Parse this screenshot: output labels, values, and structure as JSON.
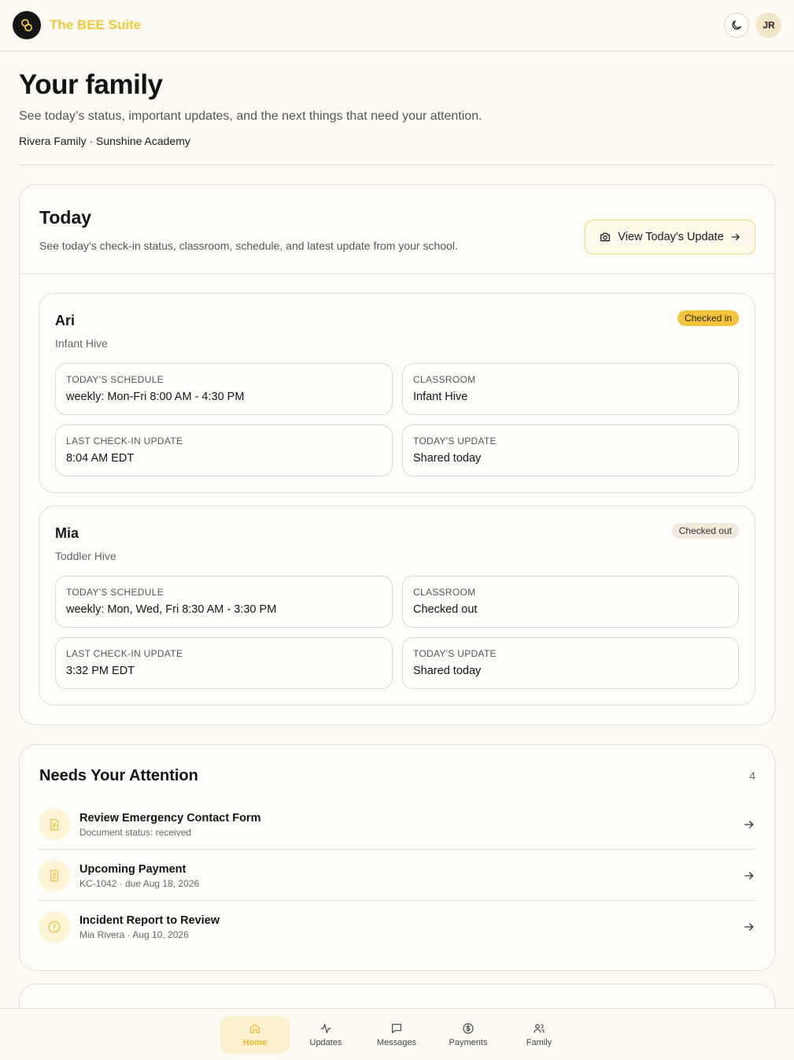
{
  "app": {
    "title": "The BEE Suite",
    "avatar_initials": "JR",
    "accent_color": "#f1c93a"
  },
  "header": {
    "title": "Your family",
    "subtitle": "See today’s status, important updates, and the next things that need your attention.",
    "meta": "Rivera Family · Sunshine Academy"
  },
  "today": {
    "title": "Today",
    "description": "See today's check-in status, classroom, schedule, and latest update from your school.",
    "view_button": "View Today's Update",
    "children": [
      {
        "name": "Ari",
        "classroom_name": "Infant Hive",
        "status": "Checked in",
        "fields": [
          {
            "label": "TODAY'S SCHEDULE",
            "value": "weekly: Mon-Fri 8:00 AM - 4:30 PM"
          },
          {
            "label": "CLASSROOM",
            "value": "Infant Hive"
          },
          {
            "label": "LAST CHECK-IN UPDATE",
            "value": "8:04 AM EDT"
          },
          {
            "label": "TODAY'S UPDATE",
            "value": "Shared today"
          }
        ]
      },
      {
        "name": "Mia",
        "classroom_name": "Toddler Hive",
        "status": "Checked out",
        "fields": [
          {
            "label": "TODAY'S SCHEDULE",
            "value": "weekly: Mon, Wed, Fri 8:30 AM - 3:30 PM"
          },
          {
            "label": "CLASSROOM",
            "value": "Checked out"
          },
          {
            "label": "LAST CHECK-IN UPDATE",
            "value": "3:32 PM EDT"
          },
          {
            "label": "TODAY'S UPDATE",
            "value": "Shared today"
          }
        ]
      }
    ]
  },
  "attention": {
    "title": "Needs Your Attention",
    "count": "4",
    "items": [
      {
        "title": "Review Emergency Contact Form",
        "subtitle": "Document status: received",
        "icon": "document-icon"
      },
      {
        "title": "Upcoming Payment",
        "subtitle": "KC-1042 · due Aug 18, 2026",
        "icon": "receipt-icon"
      },
      {
        "title": "Incident Report to Review",
        "subtitle": "Mia Rivera · Aug 10, 2026",
        "icon": "alert-circle-icon"
      }
    ]
  },
  "nav": {
    "items": [
      {
        "label": "Home",
        "icon": "home-icon"
      },
      {
        "label": "Updates",
        "icon": "activity-icon"
      },
      {
        "label": "Messages",
        "icon": "message-icon"
      },
      {
        "label": "Payments",
        "icon": "dollar-circle-icon"
      },
      {
        "label": "Family",
        "icon": "users-icon"
      }
    ]
  }
}
